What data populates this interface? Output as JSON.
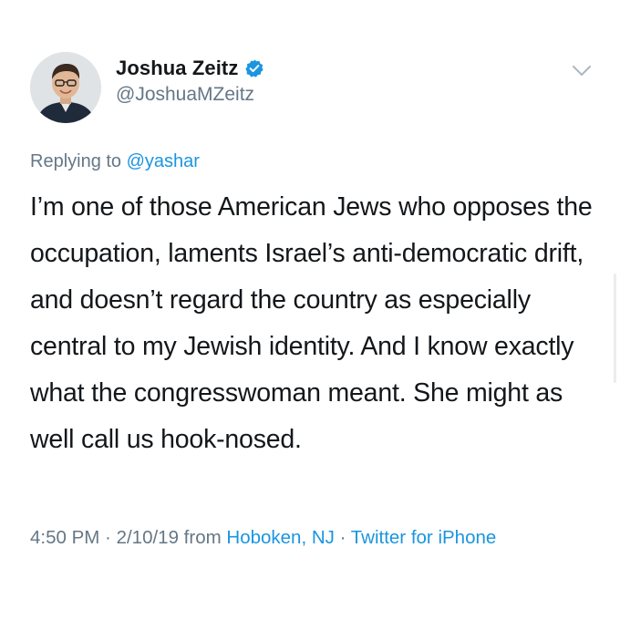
{
  "author": {
    "display_name": "Joshua Zeitz",
    "handle": "@JoshuaMZeitz",
    "verified": true,
    "avatar_icon": "person-avatar-icon"
  },
  "menu": {
    "icon": "chevron-down-icon"
  },
  "reply": {
    "prefix": "Replying to",
    "mention": "@yashar"
  },
  "tweet": {
    "text": "I’m one of those American Jews who opposes the occupation, laments Israel’s anti-democratic drift, and doesn’t regard the country as especially central to my Jewish identity. And I know exactly what the congresswoman meant. She might as well call us hook-nosed."
  },
  "meta": {
    "time": "4:50 PM",
    "separator1": " · ",
    "date": "2/10/19",
    "from_label": " from ",
    "location": "Hoboken, NJ",
    "separator2": " · ",
    "source": "Twitter for iPhone"
  },
  "colors": {
    "accent": "#1b95e0",
    "secondary_text": "#657786",
    "primary_text": "#14171a"
  }
}
